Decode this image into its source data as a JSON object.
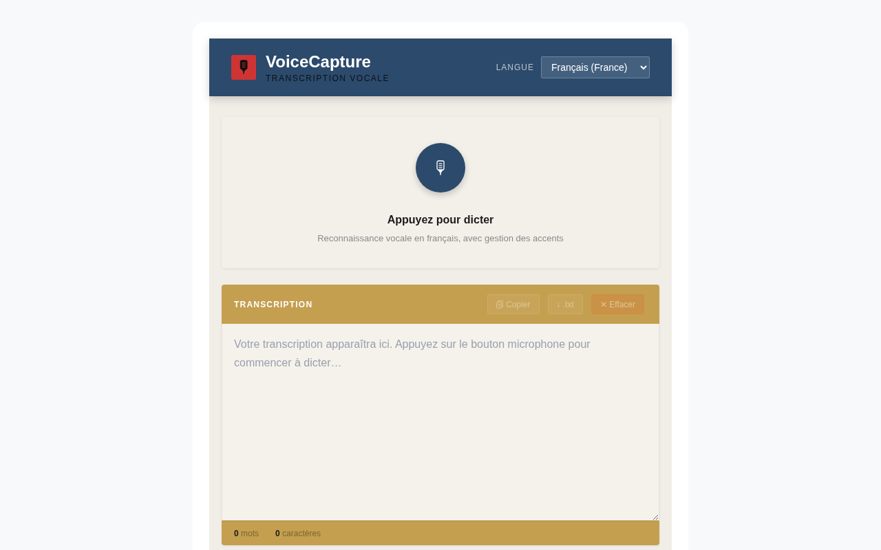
{
  "header": {
    "title": "VoiceCapture",
    "subtitle": "TRANSCRIPTION VOCALE",
    "language_label": "LANGUE",
    "language": "Français (France)"
  },
  "dictation": {
    "title": "Appuyez pour dicter",
    "subtitle": "Reconnaissance vocale en français, avec gestion des accents"
  },
  "transcription": {
    "title": "TRANSCRIPTION",
    "buttons": [
      {
        "label": "Copier",
        "kind": "copy",
        "disabled": true
      },
      {
        "label": "↓ .txt",
        "kind": "plain",
        "disabled": true
      },
      {
        "label": "✕ Effacer",
        "kind": "danger",
        "disabled": true
      }
    ],
    "placeholder": "Votre transcription apparaîtra ici. Appuyez sur le bouton microphone pour commencer à dicter…",
    "stats": [
      {
        "text": "**0** mots"
      },
      {
        "text": "**0** caractères"
      }
    ]
  }
}
